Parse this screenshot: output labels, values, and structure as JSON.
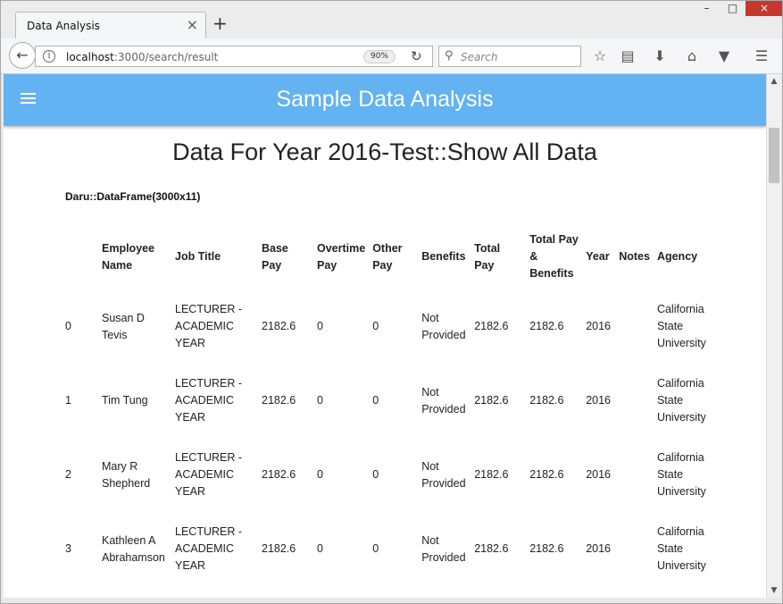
{
  "browser": {
    "tab_title": "Data Analysis",
    "tab_close": "×",
    "new_tab": "+",
    "window_controls": {
      "minimize": "–",
      "maximize": "□",
      "close": "×"
    },
    "url_host": "localhost",
    "url_path": ":3000/search/result",
    "zoom": "90%",
    "search_placeholder": "Search"
  },
  "icons": {
    "back": "back-arrow-icon",
    "info": "info-icon",
    "reload": "reload-icon",
    "search": "search-icon",
    "bookmark": "star-icon",
    "reading_list": "clipboard-icon",
    "download": "download-icon",
    "home": "home-icon",
    "pocket": "pocket-icon",
    "menu": "hamburger-icon"
  },
  "colors": {
    "header_bg": "#63b2f2",
    "header_text": "#ffffff",
    "close_button": "#c7372d"
  },
  "app": {
    "title": "Sample Data Analysis"
  },
  "page": {
    "title": "Data For Year 2016-Test::Show All Data",
    "dataframe_label": "Daru::DataFrame(3000x11)"
  },
  "table": {
    "columns": [
      "",
      "Employee Name",
      "Job Title",
      "Base Pay",
      "Overtime Pay",
      "Other Pay",
      "Benefits",
      "Total Pay",
      "Total Pay & Benefits",
      "Year",
      "Notes",
      "Agency"
    ],
    "rows": [
      [
        "0",
        "Susan D Tevis",
        "LECTURER - ACADEMIC YEAR",
        "2182.6",
        "0",
        "0",
        "Not Provided",
        "2182.6",
        "2182.6",
        "2016",
        "",
        "California State University"
      ],
      [
        "1",
        "Tim Tung",
        "LECTURER - ACADEMIC YEAR",
        "2182.6",
        "0",
        "0",
        "Not Provided",
        "2182.6",
        "2182.6",
        "2016",
        "",
        "California State University"
      ],
      [
        "2",
        "Mary R Shepherd",
        "LECTURER - ACADEMIC YEAR",
        "2182.6",
        "0",
        "0",
        "Not Provided",
        "2182.6",
        "2182.6",
        "2016",
        "",
        "California State University"
      ],
      [
        "3",
        "Kathleen A Abrahamson",
        "LECTURER - ACADEMIC YEAR",
        "2182.6",
        "0",
        "0",
        "Not Provided",
        "2182.6",
        "2182.6",
        "2016",
        "",
        "California State University"
      ]
    ]
  }
}
